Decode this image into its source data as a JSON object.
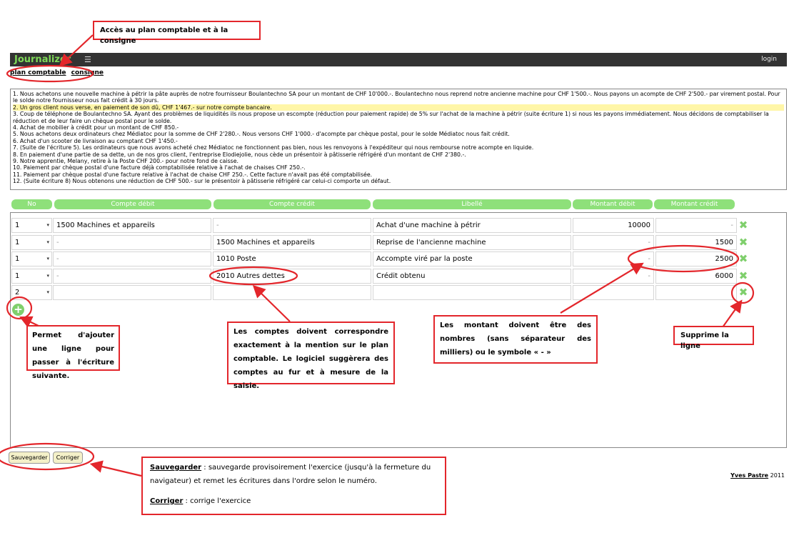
{
  "app": {
    "logo": "Journalizer",
    "menu_icon": "☰",
    "login": "login"
  },
  "nav": {
    "plan_comptable": "plan comptable",
    "consigne": "consigne"
  },
  "exercise_lines": [
    "1. Nous achetons une nouvelle machine à pétrir la pâte auprès de notre fournisseur Boulantechno SA pour un montant de CHF 10'000.-. Boulantechno nous reprend notre ancienne machine pour CHF 1'500.-. Nous payons un acompte de CHF 2'500.- par virement postal. Pour le solde notre fournisseur nous fait crédit à 30 jours.",
    "2. Un gros client nous verse, en paiement de son dû, CHF 1'467.- sur notre compte bancaire.",
    "3. Coup de téléphone de Boulantechno SA. Ayant des problèmes de liquidités ils nous propose un escompte (réduction pour paiement rapide) de 5% sur l'achat de la machine à pétrir (suite écriture 1) si nous les payons immédiatement. Nous décidons de comptabiliser la réduction et de leur faire un chèque postal pour le solde.",
    "4. Achat de mobilier à crédit pour un montant de CHF 850.-",
    "5. Nous achetons deux ordinateurs chez Médiatoc pour la somme de CHF 2'280.-. Nous versons CHF 1'000.- d'acompte par chèque postal, pour le solde Médiatoc nous fait crédit.",
    "6. Achat d'un scooter de livraison au comptant CHF 1'450.-",
    "7. (Suite de l'écriture 5). Les ordinateurs que nous avons acheté chez Médiatoc ne fonctionnent pas bien, nous les renvoyons à l'expéditeur qui nous rembourse notre acompte en liquide.",
    "8. En paiement d'une partie de sa dette, un de nos gros client, l'entreprise Elodiejolie, nous cède un présentoir à pâtisserie réfrigéré d'un montant de CHF 2'380.-.",
    "9. Notre apprentie, Melany, retire à la Poste CHF 200.- pour notre fond de caisse.",
    "10. Paiement par chèque postal d'une facture déjà comptabilisée relative à l'achat de chaises CHF 250.-.",
    "11. Paiement par chèque postal d'une facture relative à l'achat de chaise CHF 250.-. Cette facture n'avait pas été comptabilisée.",
    "12. (Suite écriture 8) Nous obtenons une réduction de CHF 500.- sur le présentoir à pâtisserie réfrigéré car celui-ci comporte un défaut."
  ],
  "headers": [
    "No",
    "Compte débit",
    "Compte crédit",
    "Libellé",
    "Montant débit",
    "Montant crédit"
  ],
  "rows": [
    {
      "no": "1",
      "debit": "1500 Machines et appareils",
      "credit": "-",
      "libelle": "Achat d'une machine à pétrir",
      "m_debit": "10000",
      "m_credit": "-"
    },
    {
      "no": "1",
      "debit": "-",
      "credit": "1500 Machines et appareils",
      "libelle": "Reprise de l'ancienne machine",
      "m_debit": "-",
      "m_credit": "1500"
    },
    {
      "no": "1",
      "debit": "-",
      "credit": "1010 Poste",
      "libelle": "Accompte viré par la poste",
      "m_debit": "-",
      "m_credit": "2500"
    },
    {
      "no": "1",
      "debit": "-",
      "credit": "2010 Autres dettes",
      "libelle": "Crédit obtenu",
      "m_debit": "-",
      "m_credit": "6000"
    },
    {
      "no": "2",
      "debit": "",
      "credit": "",
      "libelle": "",
      "m_debit": "",
      "m_credit": ""
    }
  ],
  "buttons": {
    "save": "Sauvegarder",
    "correct": "Corriger"
  },
  "footer": {
    "author": "Yves Pastre",
    "year": "2011"
  },
  "annotations": {
    "access": "Accès au plan comptable et à la consigne",
    "add": "Permet d'ajouter une ligne pour passer à l'écriture suivante.",
    "accounts": "Les comptes doivent correspondre exactement à la mention sur le plan comptable. Le logiciel suggèrera des comptes au fur et à mesure de la saisie.",
    "amounts": "Les montant doivent être des nombres (sans séparateur des milliers) ou le symbole « - »",
    "delete": "Supprime la ligne",
    "save_title": "Sauvegarder",
    "save_text": " : sauvegarde provisoirement l'exercice (jusqu'à la fermeture du navigateur) et remet les écritures dans l'ordre selon le numéro.",
    "correct_title": "Corriger",
    "correct_text": " : corrige l'exercice"
  },
  "colors": {
    "accent_green": "#7fcf6c",
    "annotation_red": "#e3262b",
    "topbar": "#333333"
  }
}
